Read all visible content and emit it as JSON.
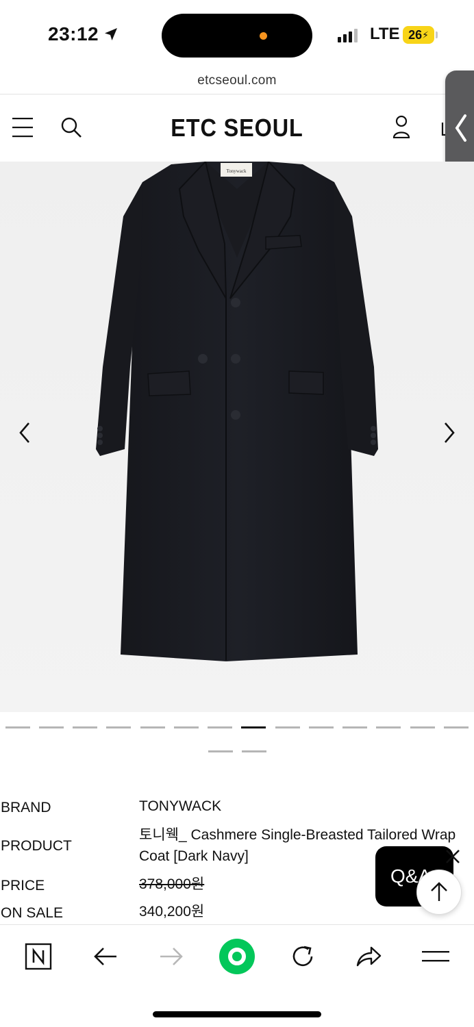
{
  "status_bar": {
    "time": "23:12",
    "network": "LTE",
    "battery": "26"
  },
  "browser": {
    "url": "etcseoul.com"
  },
  "site": {
    "logo": "ETC SEOUL",
    "icons": {
      "menu": "hamburger-menu-icon",
      "search": "search-icon",
      "account": "user-icon",
      "cart": "cart-icon"
    }
  },
  "gallery": {
    "total_slides": 16,
    "active_index": 7,
    "image_description_icon": "coat-image",
    "tag_label": "Tonywack"
  },
  "product": {
    "rows": [
      {
        "label": "BRAND",
        "value": "TONYWACK"
      },
      {
        "label": "PRODUCT",
        "value": "토니웩_ Cashmere Single-Breasted Tailored Wrap Coat [Dark Navy]"
      },
      {
        "label": "PRICE",
        "value": "378,000원"
      },
      {
        "label": "ON SALE",
        "value": "340,200원"
      }
    ]
  },
  "floating": {
    "qa_label": "Q&A"
  },
  "colors": {
    "island_dot": "#f5931e",
    "battery": "#f8d418",
    "naver_green": "#03c75a"
  }
}
